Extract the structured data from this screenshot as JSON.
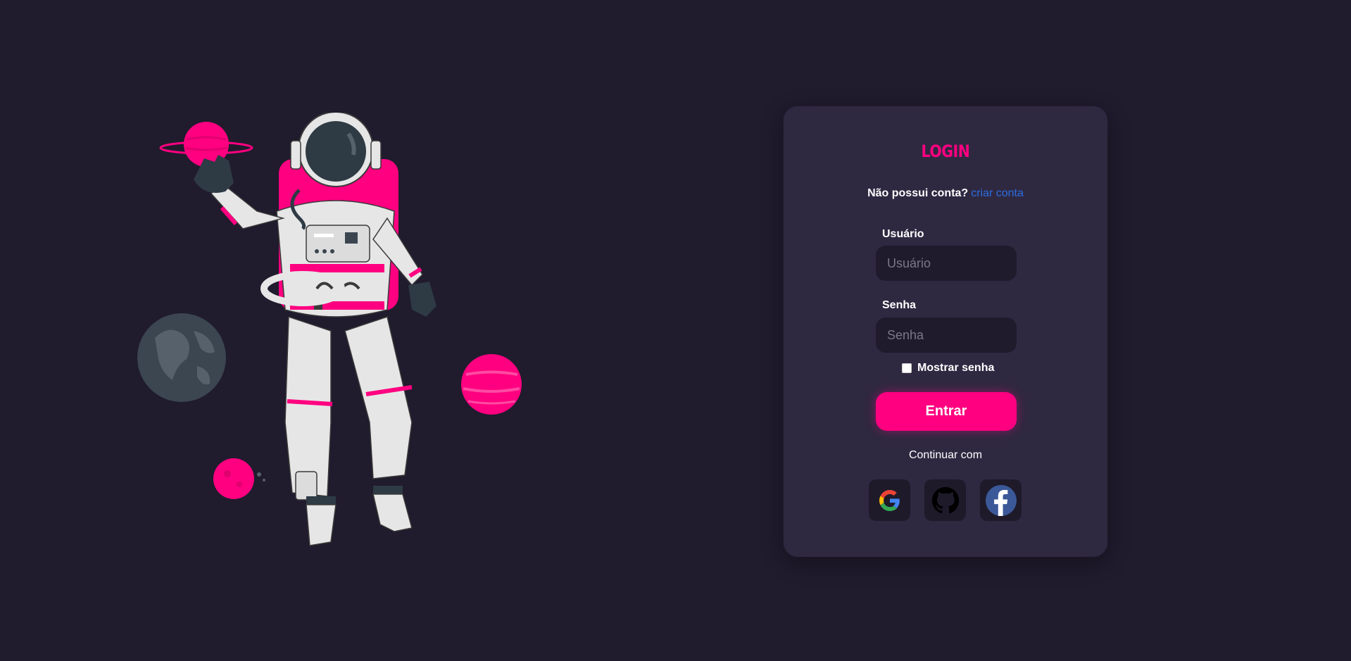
{
  "login": {
    "title": "LOGIN",
    "no_account_text": "Não possui conta?",
    "create_account_link": "criar conta",
    "username_label": "Usuário",
    "username_placeholder": "Usuário",
    "username_value": "",
    "password_label": "Senha",
    "password_placeholder": "Senha",
    "password_value": "",
    "show_password_label": "Mostrar senha",
    "show_password_checked": false,
    "submit_label": "Entrar",
    "continue_with_text": "Continuar com",
    "social_buttons": [
      {
        "provider": "google",
        "icon": "google-icon"
      },
      {
        "provider": "github",
        "icon": "github-icon"
      },
      {
        "provider": "facebook",
        "icon": "facebook-icon"
      }
    ]
  },
  "illustration": {
    "subject": "astronaut-with-planets"
  },
  "colors": {
    "background": "#201b2d",
    "card": "#2f2841",
    "accent": "#ff0080",
    "link": "#2a6ee0",
    "input": "#1f1a2c"
  }
}
